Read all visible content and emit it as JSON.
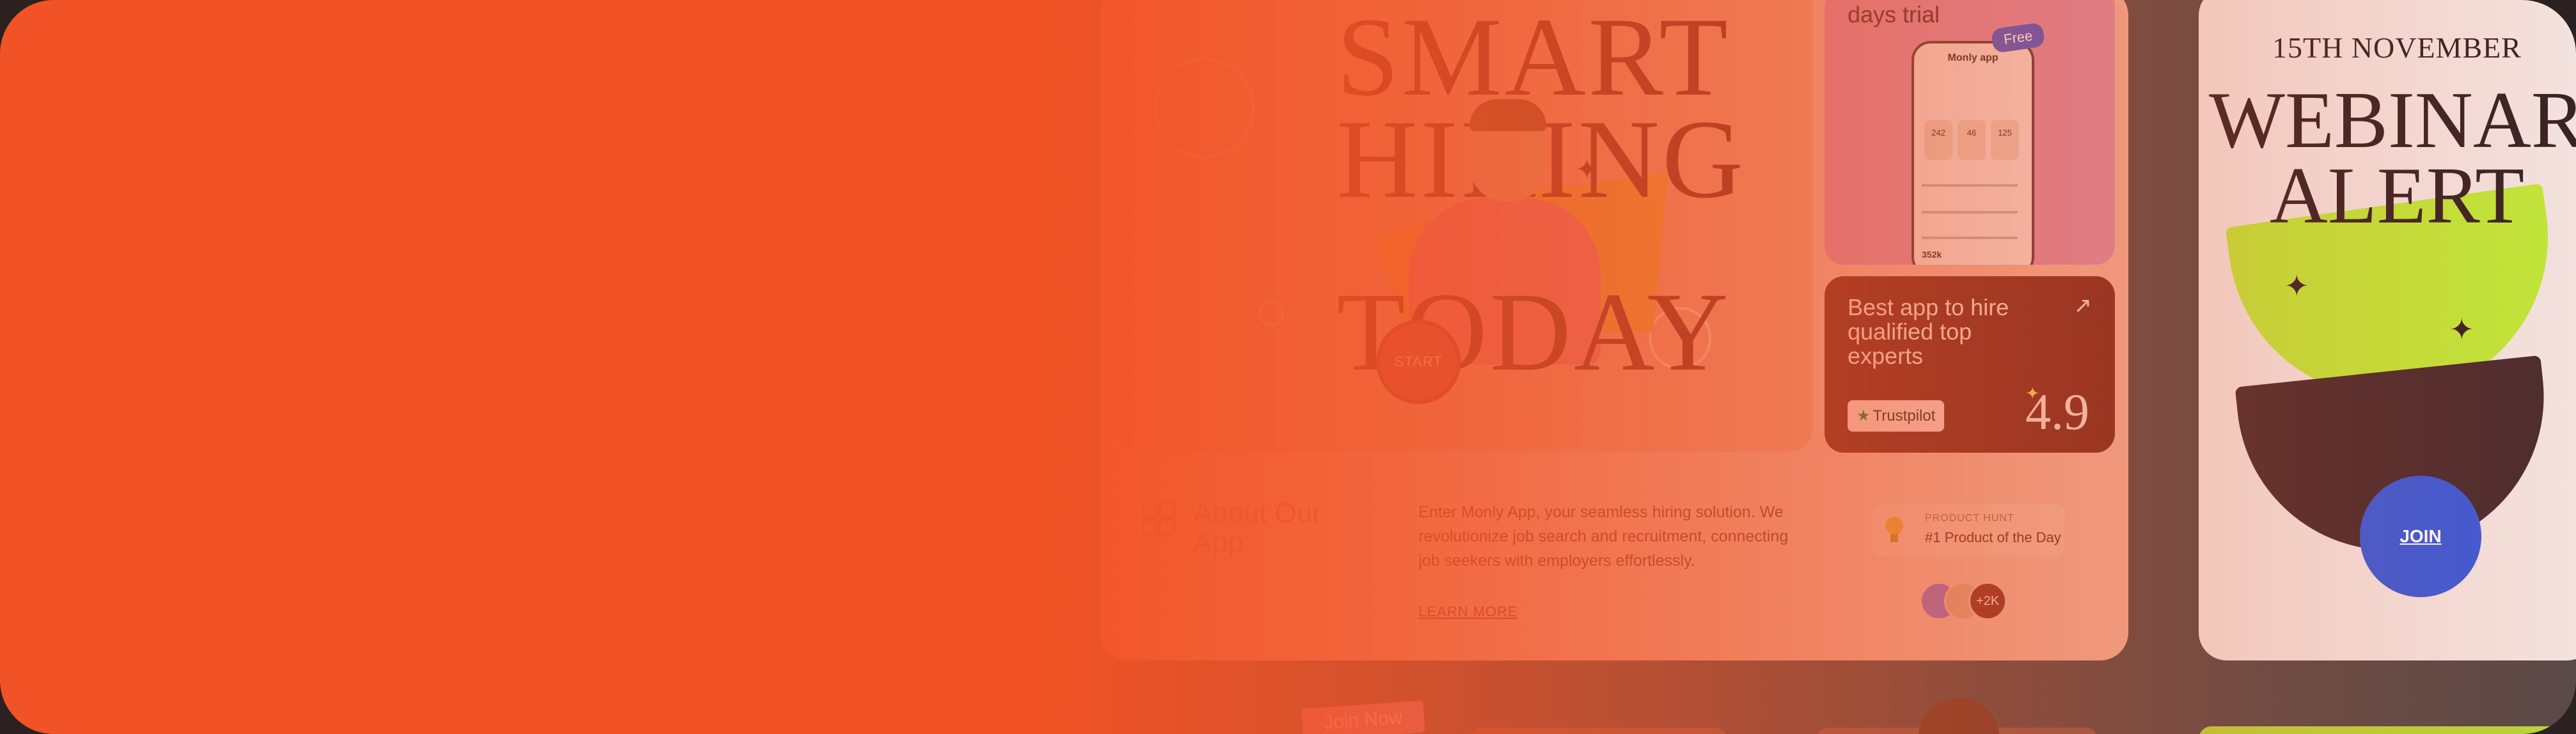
{
  "hero": {
    "headline_top": "SMART\nHIRING",
    "headline_bottom": "TODAY",
    "start_label": "START",
    "accent_colors": [
      "#eb9e7f",
      "#e6a33d",
      "#e4787d",
      "#7a2b20"
    ]
  },
  "app_card": {
    "trial_text": "days trial",
    "free_badge": "Free",
    "phone_title": "Monly app",
    "phone_stats": [
      "242",
      "46",
      "125"
    ],
    "phone_total": "352k"
  },
  "best_card": {
    "text": "Best app to hire qualified top experts",
    "trustpilot_label": "Trustpilot",
    "rating": "4.9",
    "icon": "arrow-up-right-icon"
  },
  "about": {
    "title": "About Our App",
    "description": "Enter Monly App, your seamless hiring solution. We revolutionize job search and recruitment, connecting job seekers with employers effortlessly.",
    "learn_more": "LEARN MORE"
  },
  "product_hunt": {
    "label": "PRODUCT HUNT",
    "title": "#1 Product of the Day"
  },
  "avatars": {
    "more_count": "+2K"
  },
  "webinar": {
    "date": "15TH NOVEMBER",
    "title": "WEBINAR ALERT",
    "join_label": "JOIN",
    "accent_colors": [
      "#c0e63a",
      "#4d2c2e",
      "#3d5bd6"
    ]
  },
  "bottom": {
    "join_now": "Join Now"
  },
  "overlay_color": "#f25326"
}
